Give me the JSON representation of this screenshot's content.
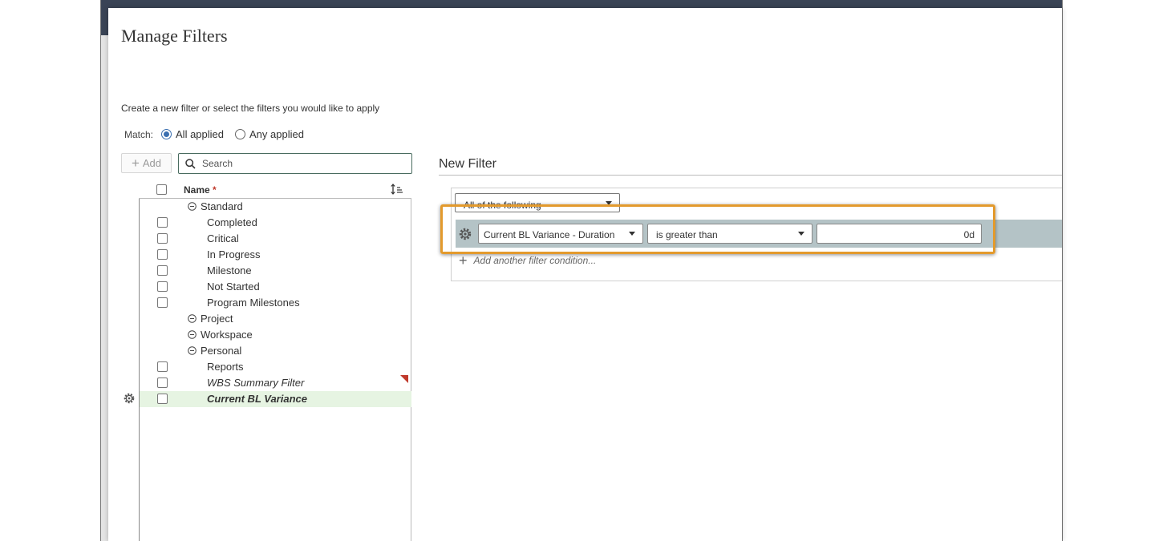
{
  "dialog": {
    "title": "Manage Filters",
    "instructions": "Create a new filter or select the filters you would like to apply"
  },
  "match": {
    "label": "Match:",
    "options": [
      {
        "label": "All applied",
        "checked": true
      },
      {
        "label": "Any applied",
        "checked": false
      }
    ]
  },
  "toolbar": {
    "add_label": "Add",
    "search_placeholder": "Search"
  },
  "list": {
    "column_name": "Name",
    "required_marker": "*",
    "items": [
      {
        "type": "group",
        "label": "Standard"
      },
      {
        "type": "item",
        "label": "Completed"
      },
      {
        "type": "item",
        "label": "Critical"
      },
      {
        "type": "item",
        "label": "In Progress"
      },
      {
        "type": "item",
        "label": "Milestone"
      },
      {
        "type": "item",
        "label": "Not Started"
      },
      {
        "type": "item",
        "label": "Program Milestones"
      },
      {
        "type": "group",
        "label": "Project"
      },
      {
        "type": "group",
        "label": "Workspace"
      },
      {
        "type": "group",
        "label": "Personal"
      },
      {
        "type": "item",
        "label": "Reports"
      },
      {
        "type": "item",
        "label": "WBS Summary Filter",
        "italic": true
      },
      {
        "type": "item",
        "label": "Current BL Variance",
        "italic": true,
        "selected": true
      }
    ]
  },
  "new_filter": {
    "title": "New Filter",
    "match_select": "All of the following",
    "condition": {
      "field": "Current BL Variance - Duration",
      "operator": "is greater than",
      "value": "0d"
    },
    "add_condition_label": "Add another filter condition..."
  },
  "colors": {
    "highlight": "#e39a2d",
    "condition_band": "#b4c3c6",
    "selected_row": "#e6f4e2",
    "radio_accent": "#3a6fb0"
  }
}
